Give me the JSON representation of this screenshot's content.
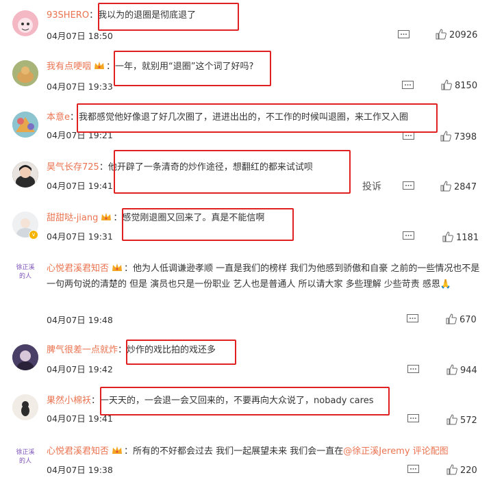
{
  "comments": [
    {
      "user": "93SHERO",
      "sep": "：",
      "text": "我以为的退圈是彻底退了",
      "time": "04月07日 18:50",
      "likes": "20926",
      "crown": false,
      "avatar": "pink"
    },
    {
      "user": "我有点哽咽",
      "sep": "：",
      "text": "一年，就别用“退圈”这个词了好吗?",
      "time": "04月07日 19:33",
      "likes": "8150",
      "crown": true,
      "avatar": "green"
    },
    {
      "user": "本意e",
      "sep": "：",
      "text": "我都感觉他好像退了好几次圈了，进进出出的，不工作的时候叫退圈，来工作又入圈",
      "time": "04月07日 19:21",
      "likes": "7398",
      "crown": false,
      "avatar": "colorful"
    },
    {
      "user": "昊气长存725",
      "sep": "：",
      "text": "他开辟了一条清奇的炒作途径，想翻红的都来试试呗",
      "time": "04月07日 19:41",
      "likes": "2847",
      "crown": false,
      "avatar": "dark",
      "report": "投诉"
    },
    {
      "user": "甜甜哒-jiang",
      "sep": "：",
      "text": "感觉刚退圈又回来了。真是不能信啊",
      "time": "04月07日 19:31",
      "likes": "1181",
      "crown": true,
      "avatar": "white"
    },
    {
      "user": "心悦君溪君知否",
      "sep": "：",
      "text": "他为人低调谦逊孝顺 一直是我们的榜样 我们为他感到骄傲和自豪 之前的一些情况也不是一句两句说的清楚的 但是 演员也只是一份职业 艺人也是普通人 所以请大家 多些理解 少些苛责 感恩🙏",
      "time": "04月07日 19:48",
      "likes": "670",
      "crown": true,
      "avatar": "text"
    },
    {
      "user": "脾气很差一点就炸",
      "sep": "：",
      "text": "炒作的戏比拍的戏还多",
      "time": "04月07日 19:42",
      "likes": "944",
      "crown": false,
      "avatar": "purple"
    },
    {
      "user": "果然小棉袄",
      "sep": "：",
      "text": "一天天的，一会退一会又回来的，不要再向大众说了，nobady cares",
      "time": "04月07日 19:41",
      "likes": "572",
      "crown": false,
      "avatar": "cat"
    },
    {
      "user": "心悦君溪君知否",
      "sep": "：",
      "text": "所有的不好都会过去 我们一起展望未来 我们会一直在",
      "mention": "@徐正溪Jeremy",
      "suffix": " 评论配图",
      "time": "04月07日 19:38",
      "likes": "220",
      "crown": true,
      "avatar": "text"
    }
  ],
  "avatar_text": "徐正溪的人"
}
